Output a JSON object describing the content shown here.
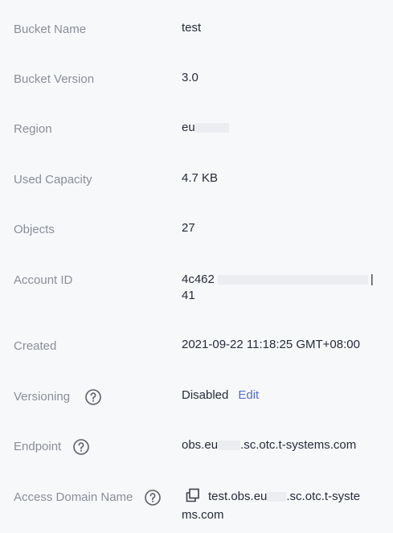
{
  "rows": {
    "bucket_name": {
      "label": "Bucket Name",
      "value": "test"
    },
    "bucket_version": {
      "label": "Bucket Version",
      "value": "3.0"
    },
    "region": {
      "label": "Region",
      "value": "eu"
    },
    "used_capacity": {
      "label": "Used Capacity",
      "value": "4.7 KB"
    },
    "objects": {
      "label": "Objects",
      "value": "27"
    },
    "account_id": {
      "label": "Account ID",
      "value_prefix": "4c462",
      "value_line2": "41"
    },
    "created": {
      "label": "Created",
      "value": "2021-09-22 11:18:25 GMT+08:00"
    },
    "versioning": {
      "label": "Versioning",
      "value": "Disabled",
      "edit_label": "Edit"
    },
    "endpoint": {
      "label": "Endpoint",
      "value_prefix": "obs.eu",
      "value_suffix": ".sc.otc.t-systems.com"
    },
    "access_domain": {
      "label": "Access Domain Name",
      "value_prefix": "test.obs.eu",
      "value_suffix": ".sc.otc.t-syste",
      "value_line2": "ms.com"
    }
  },
  "icons": {
    "help": "question-circle-icon",
    "copy": "copy-icon"
  },
  "colors": {
    "background": "#f7f8f9",
    "label": "#8a8e99",
    "value": "#252b3a",
    "link": "#526ecc"
  }
}
